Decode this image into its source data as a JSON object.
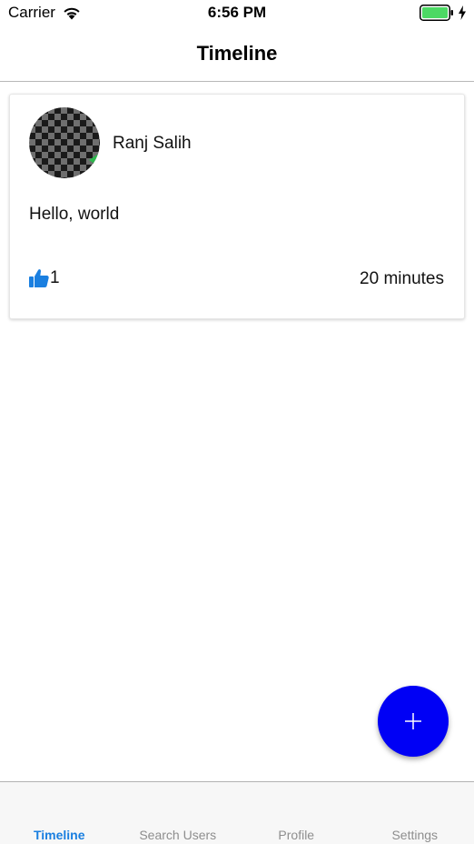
{
  "status_bar": {
    "carrier": "Carrier",
    "time": "6:56 PM",
    "wifi_icon": "wifi-icon",
    "battery_icon": "battery-full-icon",
    "charging_icon": "bolt-icon",
    "battery_color": "#4cd964"
  },
  "nav": {
    "title": "Timeline"
  },
  "post": {
    "author": "Ranj Salih",
    "avatar_icon": "checkerboard-avatar",
    "text": "Hello, world",
    "likes": "1",
    "like_icon": "thumbs-up-icon",
    "time": "20 minutes"
  },
  "fab": {
    "icon": "plus-icon",
    "color": "#0000f5"
  },
  "tabs": [
    {
      "label": "Timeline",
      "active": true
    },
    {
      "label": "Search Users",
      "active": false
    },
    {
      "label": "Profile",
      "active": false
    },
    {
      "label": "Settings",
      "active": false
    }
  ],
  "colors": {
    "accent": "#1a7fe0",
    "like": "#1a7fe0",
    "tab_inactive": "#8e8e8e"
  }
}
